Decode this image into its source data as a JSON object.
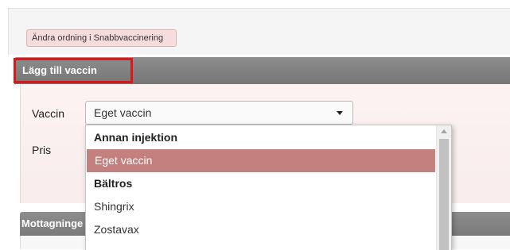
{
  "toolbar": {
    "reorder_label": "Ändra ordning i Snabbvaccinering"
  },
  "add_vaccine": {
    "title": "Lägg till vaccin",
    "vaccine_label": "Vaccin",
    "vaccine_value": "Eget vaccin",
    "price_label": "Pris"
  },
  "dropdown": {
    "options": [
      {
        "label": "Annan injektion",
        "group": true
      },
      {
        "label": "Eget vaccin",
        "selected": true
      },
      {
        "label": "Bältros",
        "group": true
      },
      {
        "label": "Shingrix"
      },
      {
        "label": "Zostavax"
      }
    ]
  },
  "reception": {
    "title": "Mottagninge"
  },
  "colors": {
    "accent": "#c47f7f",
    "header": "#808080",
    "highlight_border": "#e01515",
    "button_bg": "#f6dcdc"
  },
  "icons": {
    "select_caret": "chevron-down-icon",
    "scroll_up": "arrow-up-icon"
  }
}
